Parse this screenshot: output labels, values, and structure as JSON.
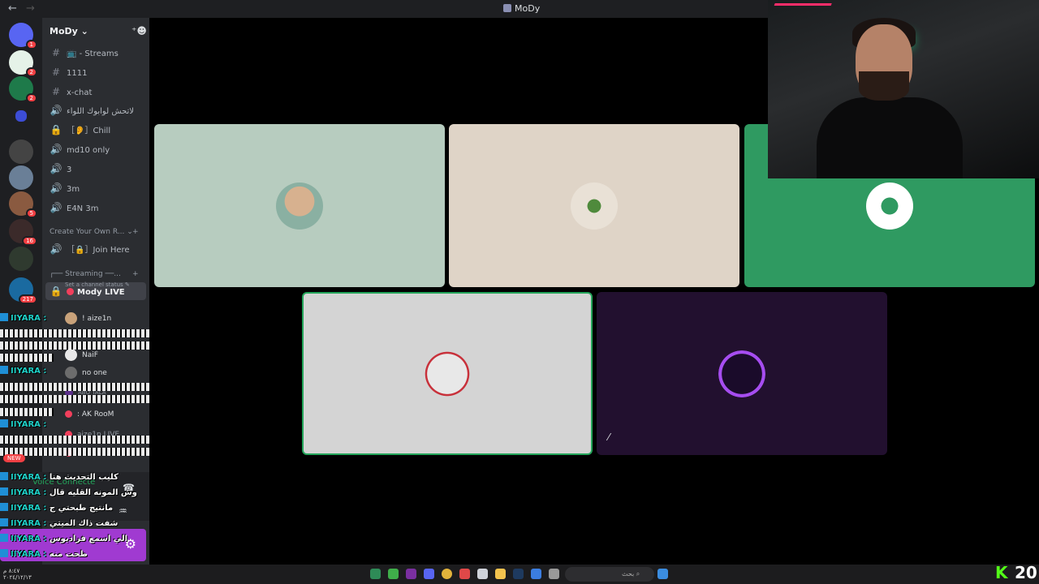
{
  "window": {
    "title": "MoDy",
    "back": "←",
    "forward": "→"
  },
  "server": {
    "name": "MoDy ⌄",
    "add_member_icon": "add-person-icon"
  },
  "channels": [
    {
      "type": "text",
      "label": "📺 - Streams"
    },
    {
      "type": "text",
      "label": "1111"
    },
    {
      "type": "text",
      "label": "x-chat"
    },
    {
      "type": "voice",
      "label": "لاتحش لوابوك اللواء"
    },
    {
      "type": "locked",
      "label": "［👂］Chill"
    },
    {
      "type": "voice",
      "label": "md10 only"
    },
    {
      "type": "voice",
      "label": "3"
    },
    {
      "type": "voice",
      "label": "3m"
    },
    {
      "type": "voice",
      "label": "E4N 3m"
    }
  ],
  "category_create": {
    "label": "Create Your Own R... ⌄",
    "join": "［🔒］Join Here"
  },
  "category_streaming": {
    "label": "┌── Streaming ──..."
  },
  "active_channel": {
    "label": "Mody LIVE",
    "status_hint": "Set a channel status ✎"
  },
  "members": [
    {
      "name": "! aize1n"
    },
    {
      "name": "NaiF"
    },
    {
      "name": "no one"
    },
    {
      "name": "ABO TALA"
    }
  ],
  "other_channels": [
    {
      "label": ": AK RooM"
    },
    {
      "label": "aize1n LIVE"
    },
    {
      "label": "ATUSM LIVE"
    }
  ],
  "voice": {
    "status": "Voice Connecte"
  },
  "chat_overlay": [
    {
      "name": "IIYARA :",
      "msg": ""
    },
    {
      "name": "IIYARA :",
      "msg": ""
    },
    {
      "name": "IIYARA :",
      "msg": ""
    },
    {
      "name": "IIYARA :",
      "msg": "كليب التحديث هنا"
    },
    {
      "name": "IIYARA :",
      "msg": "وش المونه القليه قال"
    },
    {
      "name": "IIYARA :",
      "msg": "مانتيج طبحتي ج"
    },
    {
      "name": "IIYARA :",
      "msg": "شفت ذاك الميتي"
    },
    {
      "name": "IIYARA :",
      "msg": "الي اسمع فراديوس"
    },
    {
      "name": "IIYARA :",
      "msg": "طحت منه"
    }
  ],
  "new_badge": "NEW",
  "guild_badges": [
    "1",
    "2",
    "2",
    "5",
    "16",
    "217"
  ],
  "taskbar": {
    "search_placeholder": "بحث",
    "time": "٨:٤٧ م\n٢٠٢٤/١٢/١٣"
  },
  "kick": {
    "logo": "K",
    "count": "20"
  },
  "colors": {
    "accent": "#5865f2",
    "speaking": "#23a55a",
    "user_panel": "#a03ad1",
    "kick_green": "#53fc18"
  }
}
